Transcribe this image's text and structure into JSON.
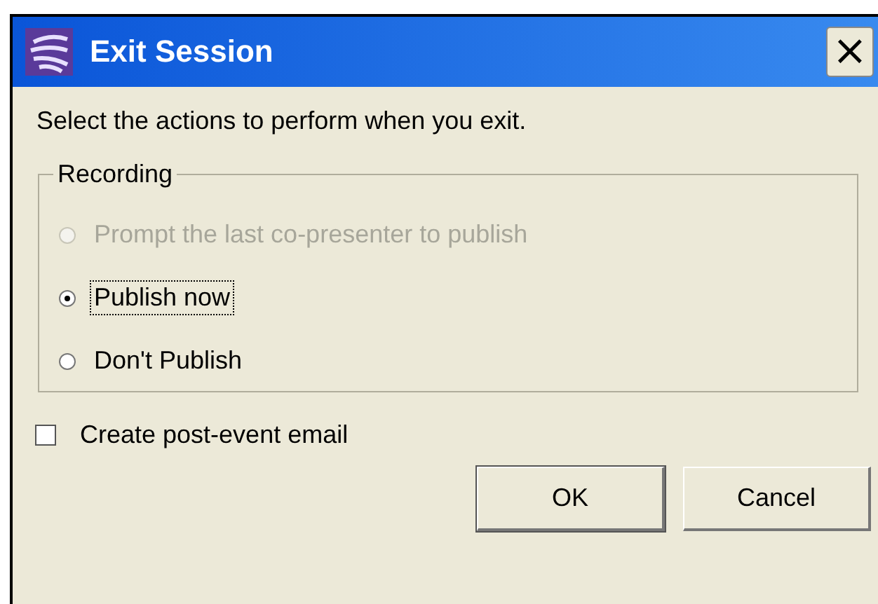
{
  "window": {
    "title": "Exit Session",
    "close": "×"
  },
  "instruction": "Select the actions to perform when you exit.",
  "recording": {
    "legend": "Recording",
    "options": [
      {
        "label": "Prompt the last co-presenter to publish",
        "selected": false,
        "disabled": true,
        "focused": false
      },
      {
        "label": "Publish now",
        "selected": true,
        "disabled": false,
        "focused": true
      },
      {
        "label": "Don't Publish",
        "selected": false,
        "disabled": false,
        "focused": false
      }
    ]
  },
  "email_option": {
    "label": "Create post-event email",
    "checked": false
  },
  "buttons": [
    {
      "label": "OK",
      "default": true
    },
    {
      "label": "Cancel",
      "default": false
    }
  ]
}
